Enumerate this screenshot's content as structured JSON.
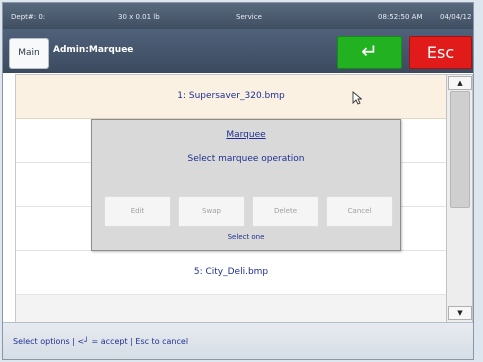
{
  "status_bar": {
    "dept": "Dept#: 0:",
    "weight": "30 x 0.01 lb",
    "mode": "Service",
    "time": "08:52:50 AM",
    "date": "04/04/12"
  },
  "header": {
    "main_label": "Main",
    "title": "Admin:Marquee",
    "enter_glyph": "↵",
    "esc_label": "Esc"
  },
  "list": {
    "items": [
      {
        "label": "1: Supersaver_320.bmp",
        "selected": true
      },
      {
        "label": "5: City_Deli.bmp",
        "selected": false
      }
    ]
  },
  "dialog": {
    "title": "Marquee",
    "prompt": "Select marquee operation",
    "buttons": [
      "Edit",
      "Swap",
      "Delete",
      "Cancel"
    ],
    "hint": "Select one"
  },
  "footer": {
    "text": "Select options | <┘ = accept | Esc to cancel"
  },
  "colors": {
    "accept": "#22b120",
    "escape": "#e11a1a",
    "text_blue": "#1e2f90",
    "selected_row": "#fbf1e3"
  },
  "icons": [
    "enter-arrow-icon",
    "mouse-pointer-icon",
    "scroll-up-arrow-icon",
    "scroll-down-arrow-icon"
  ]
}
